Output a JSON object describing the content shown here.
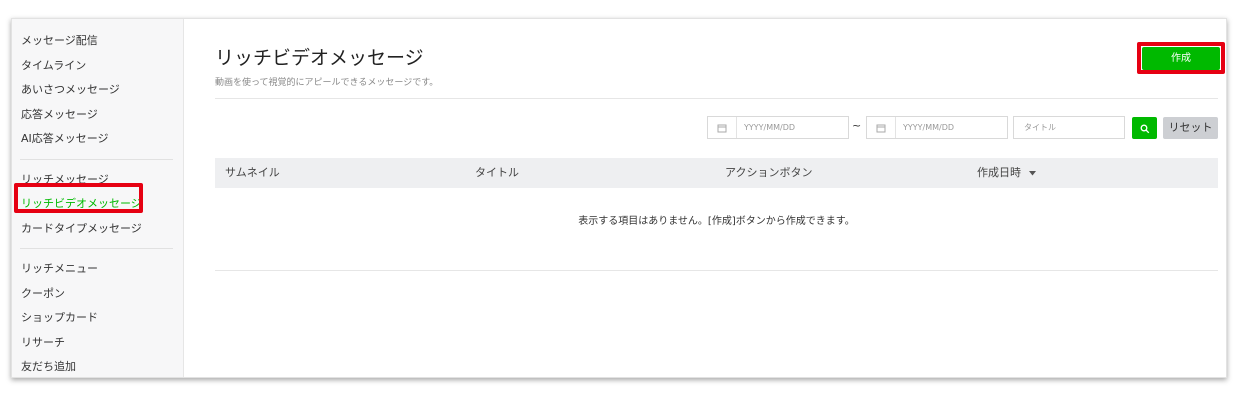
{
  "sidebar": {
    "group1": [
      {
        "label": "メッセージ配信"
      },
      {
        "label": "タイムライン"
      },
      {
        "label": "あいさつメッセージ"
      },
      {
        "label": "応答メッセージ"
      },
      {
        "label": "AI応答メッセージ"
      }
    ],
    "group2": [
      {
        "label": "リッチメッセージ"
      },
      {
        "label": "リッチビデオメッセージ"
      },
      {
        "label": "カードタイプメッセージ"
      }
    ],
    "group3": [
      {
        "label": "リッチメニュー"
      },
      {
        "label": "クーポン"
      },
      {
        "label": "ショップカード"
      },
      {
        "label": "リサーチ"
      },
      {
        "label": "友だち追加"
      }
    ]
  },
  "header": {
    "title": "リッチビデオメッセージ",
    "subtitle": "動画を使って視覚的にアピールできるメッセージです。",
    "create_label": "作成"
  },
  "filters": {
    "start_date_placeholder": "YYYY/MM/DD",
    "tilde": "~",
    "end_date_placeholder": "YYYY/MM/DD",
    "title_placeholder": "タイトル",
    "reset_label": "リセット"
  },
  "table": {
    "columns": [
      "サムネイル",
      "タイトル",
      "アクションボタン",
      "作成日時"
    ],
    "empty_message": "表示する項目はありません。[作成]ボタンから作成できます。"
  },
  "colors": {
    "accent": "#00b900",
    "highlight": "#e60012"
  }
}
